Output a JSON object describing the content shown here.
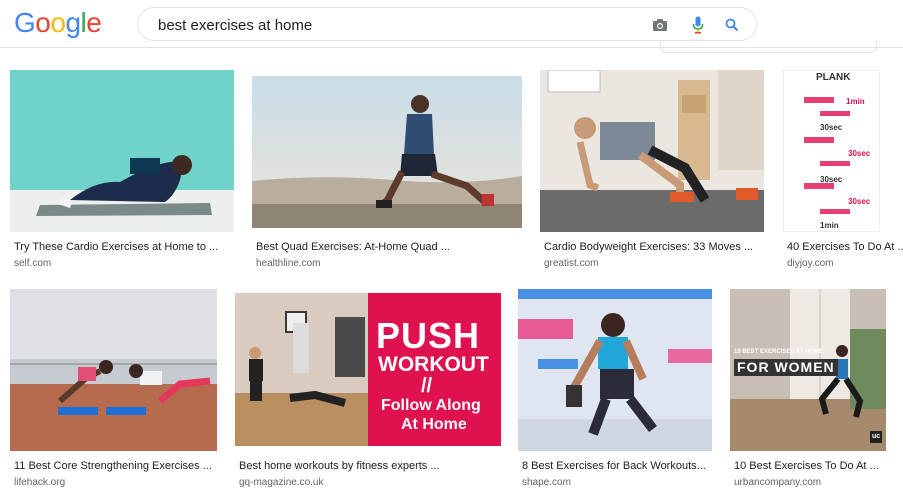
{
  "search": {
    "query": "best exercises at home",
    "camera_icon": "camera-icon",
    "mic_icon": "microphone-icon",
    "search_icon": "search-icon"
  },
  "logo": {
    "letters": [
      "G",
      "o",
      "o",
      "g",
      "l",
      "e"
    ],
    "colors": [
      "#4285F4",
      "#EA4335",
      "#FBBC05",
      "#4285F4",
      "#34A853",
      "#EA4335"
    ]
  },
  "results": [
    {
      "caption": "Try These Cardio Exercises at Home to ...",
      "source": "self.com"
    },
    {
      "caption": "Best Quad Exercises: At-Home Quad ...",
      "source": "healthline.com"
    },
    {
      "caption": "Cardio Bodyweight Exercises: 33 Moves ...",
      "source": "greatist.com"
    },
    {
      "caption": "40 Exercises To Do At ...",
      "source": "diyjoy.com"
    },
    {
      "caption": "11 Best Core Strengthening Exercises ...",
      "source": "lifehack.org"
    },
    {
      "caption": "Best home workouts by fitness experts ...",
      "source": "gq-magazine.co.uk"
    },
    {
      "caption": "8 Best Exercises for Back Workouts...",
      "source": "shape.com"
    },
    {
      "caption": "10 Best Exercises To Do At ...",
      "source": "urbancompany.com"
    }
  ],
  "thumb_text": {
    "plank": "PLANK",
    "plank_times": [
      "1min",
      "30sec",
      "30sec",
      "30sec",
      "30sec",
      "1min"
    ],
    "push": "PUSH",
    "workout": "WORKOUT",
    "slashes": "//",
    "follow": "Follow Along",
    "athome": "At Home",
    "uc_small": "10 BEST EXERCISES AT HOME",
    "for_women": "FOR WOMEN",
    "uc_logo": "uc"
  },
  "colors": {
    "pink": "#e0114f",
    "teal": "#6ed3c9"
  }
}
